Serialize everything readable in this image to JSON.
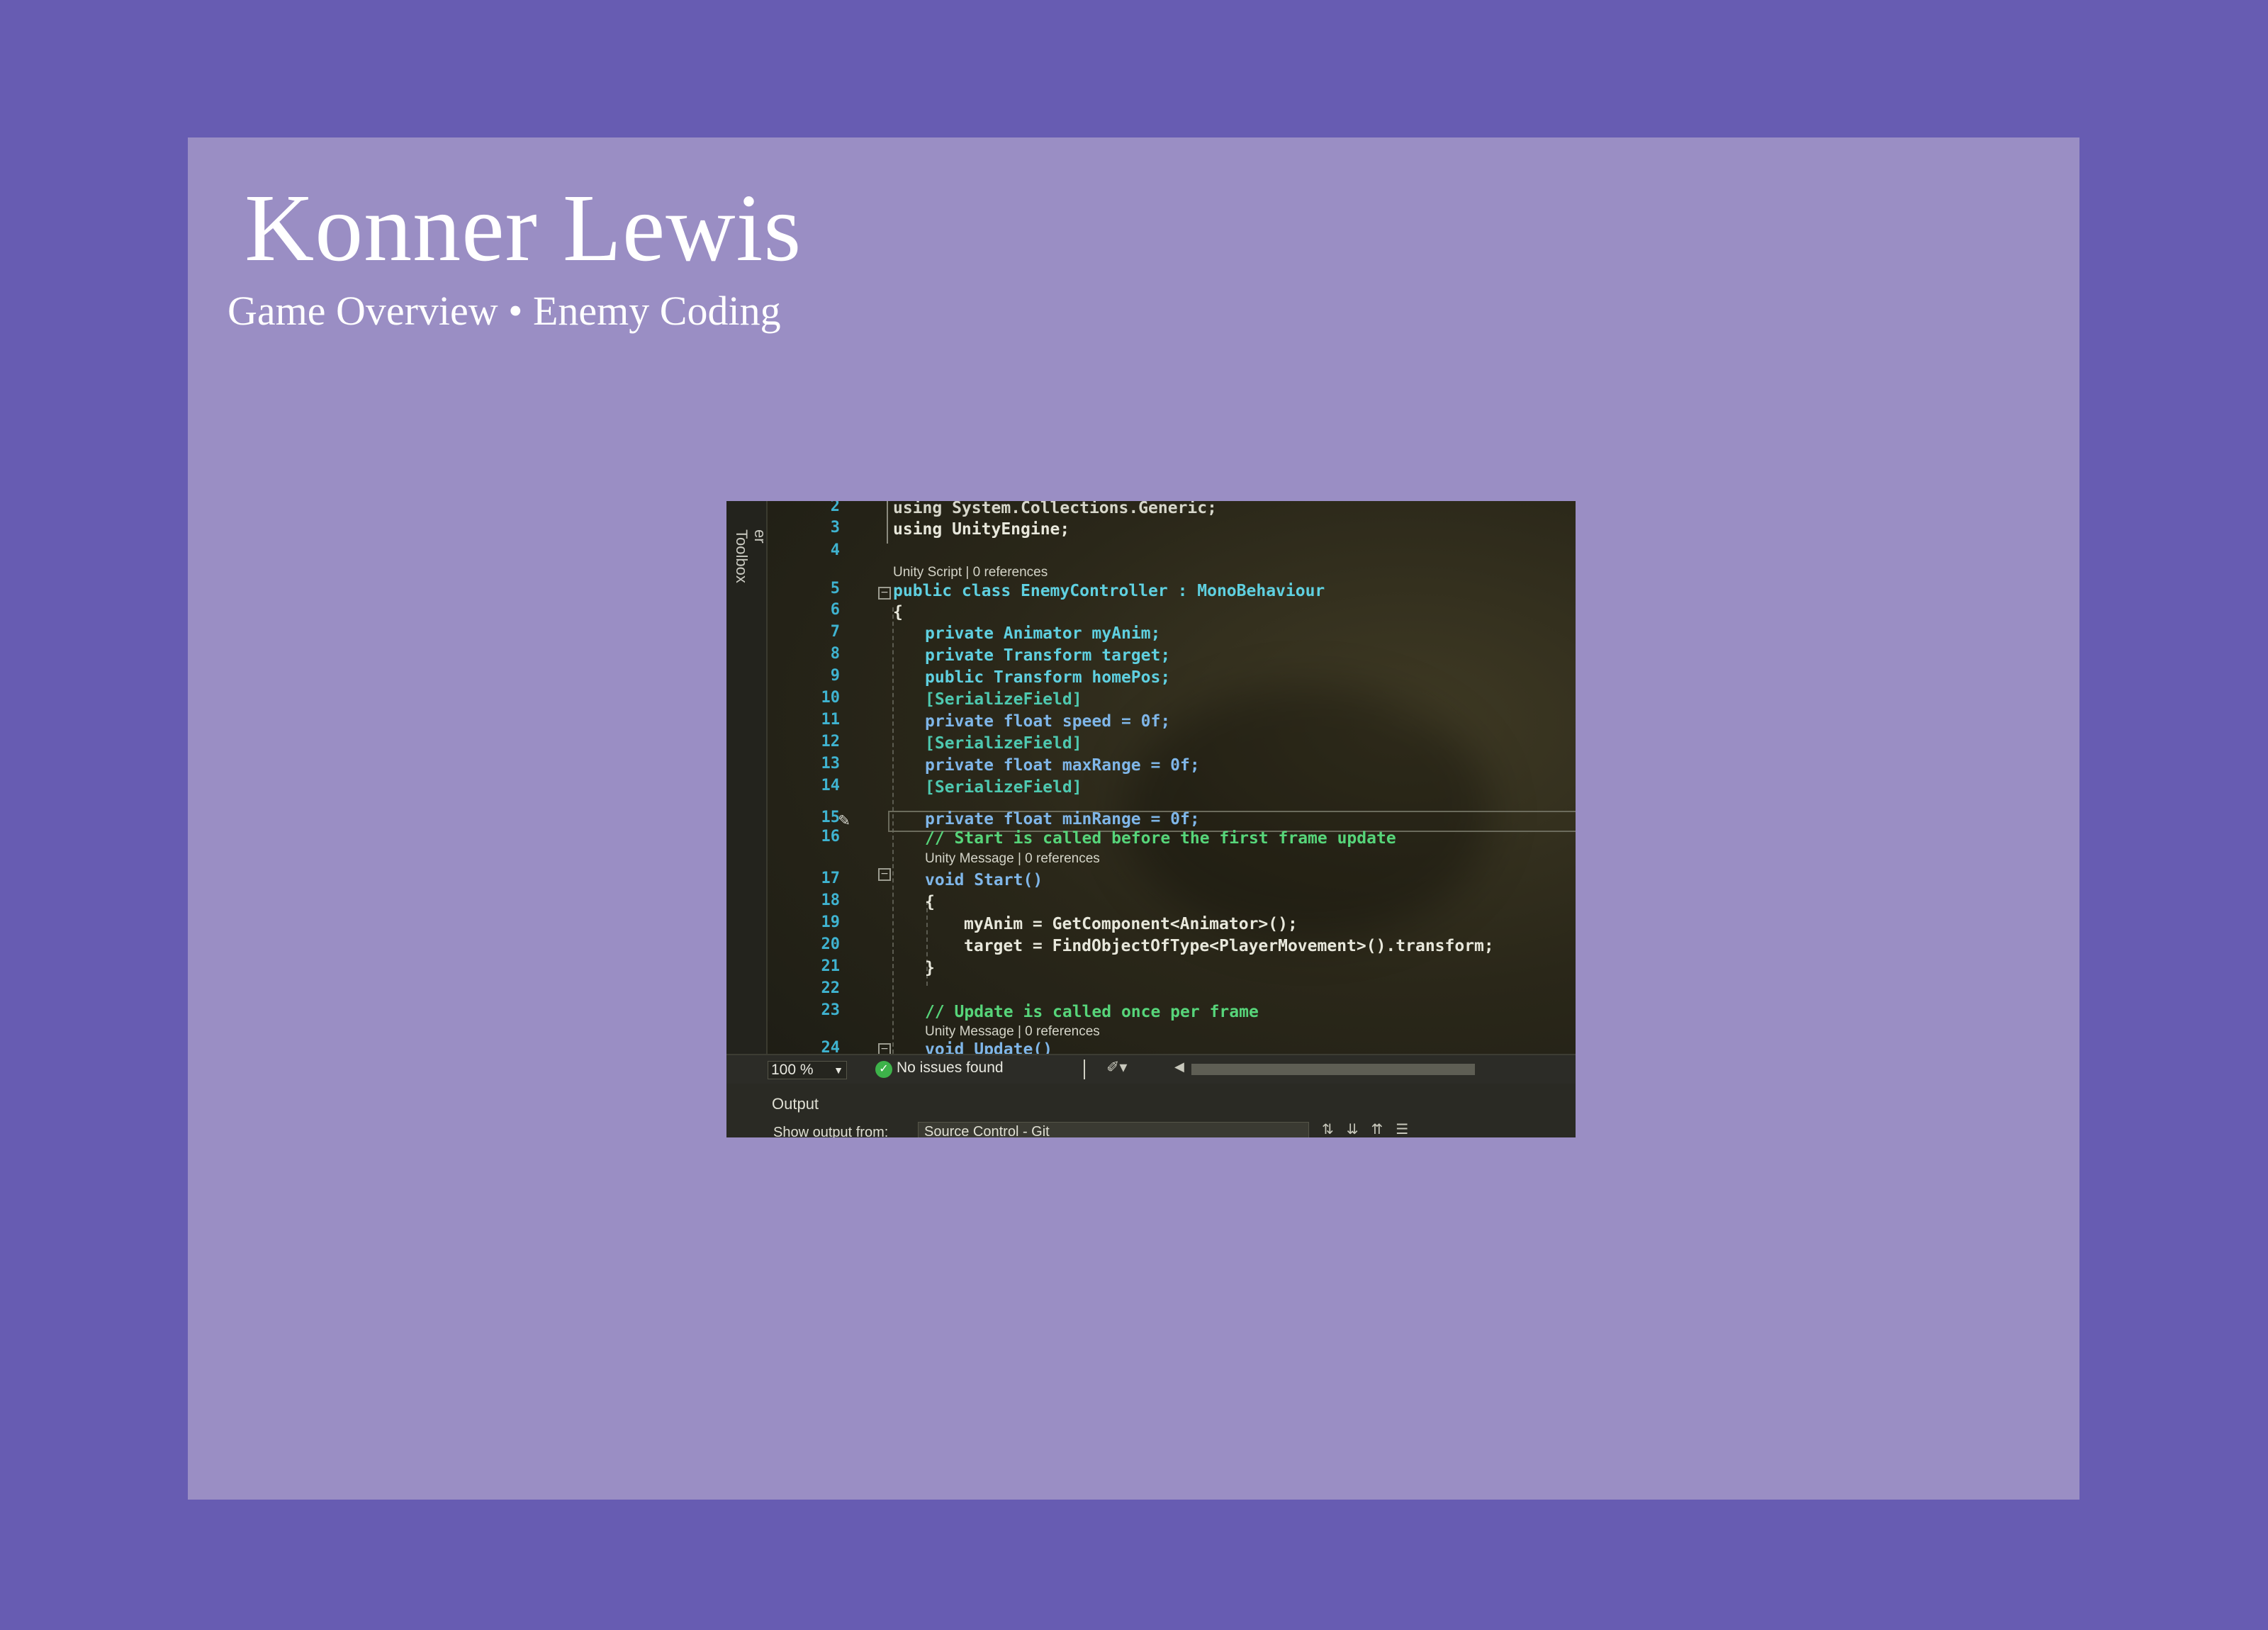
{
  "slide": {
    "title": "Konner Lewis",
    "subtitle": "Game Overview • Enemy Coding"
  },
  "colors": {
    "outer_background": "#675cb2",
    "panel_background": "#9a8ec4",
    "title_text": "#ffffff"
  },
  "editor": {
    "side_tab_partial": "er",
    "side_tab": "Toolbox",
    "lines": [
      {
        "n": "2",
        "text": "using System.Collections.Generic;"
      },
      {
        "n": "3",
        "text": "using UnityEngine;"
      },
      {
        "n": "4",
        "text": ""
      },
      {
        "n": "5",
        "text": "public class EnemyController : MonoBehaviour"
      },
      {
        "n": "6",
        "text": "{"
      },
      {
        "n": "7",
        "text": "private Animator myAnim;"
      },
      {
        "n": "8",
        "text": "private Transform target;"
      },
      {
        "n": "9",
        "text": "public Transform homePos;"
      },
      {
        "n": "10",
        "text": "[SerializeField]"
      },
      {
        "n": "11",
        "text": "private float speed = 0f;"
      },
      {
        "n": "12",
        "text": "[SerializeField]"
      },
      {
        "n": "13",
        "text": "private float maxRange = 0f;"
      },
      {
        "n": "14",
        "text": "[SerializeField]"
      },
      {
        "n": "15",
        "text": "private float minRange = 0f;"
      },
      {
        "n": "16",
        "text": "// Start is called before the first frame update"
      },
      {
        "n": "17",
        "text": "void Start()"
      },
      {
        "n": "18",
        "text": "{"
      },
      {
        "n": "19",
        "text": "myAnim = GetComponent<Animator>();"
      },
      {
        "n": "20",
        "text": "target = FindObjectOfType<PlayerMovement>().transform;"
      },
      {
        "n": "21",
        "text": "}"
      },
      {
        "n": "22",
        "text": ""
      },
      {
        "n": "23",
        "text": "// Update is called once per frame"
      },
      {
        "n": "24",
        "text": "void Update()"
      }
    ],
    "codelens": {
      "class": "Unity Script | 0 references",
      "start": "Unity Message | 0 references",
      "update": "Unity Message | 0 references"
    },
    "current_line": "15",
    "icons": [
      "pencil-icon",
      "collapse-icon",
      "unity-icon"
    ]
  },
  "statusbar": {
    "zoom": "100 %",
    "issues": "No issues found",
    "icons": [
      "check-circle-icon",
      "brush-icon",
      "chevron-left-icon"
    ]
  },
  "output": {
    "title": "Output",
    "show_output_from": "Show output from:",
    "source": "Source Control - Git"
  }
}
